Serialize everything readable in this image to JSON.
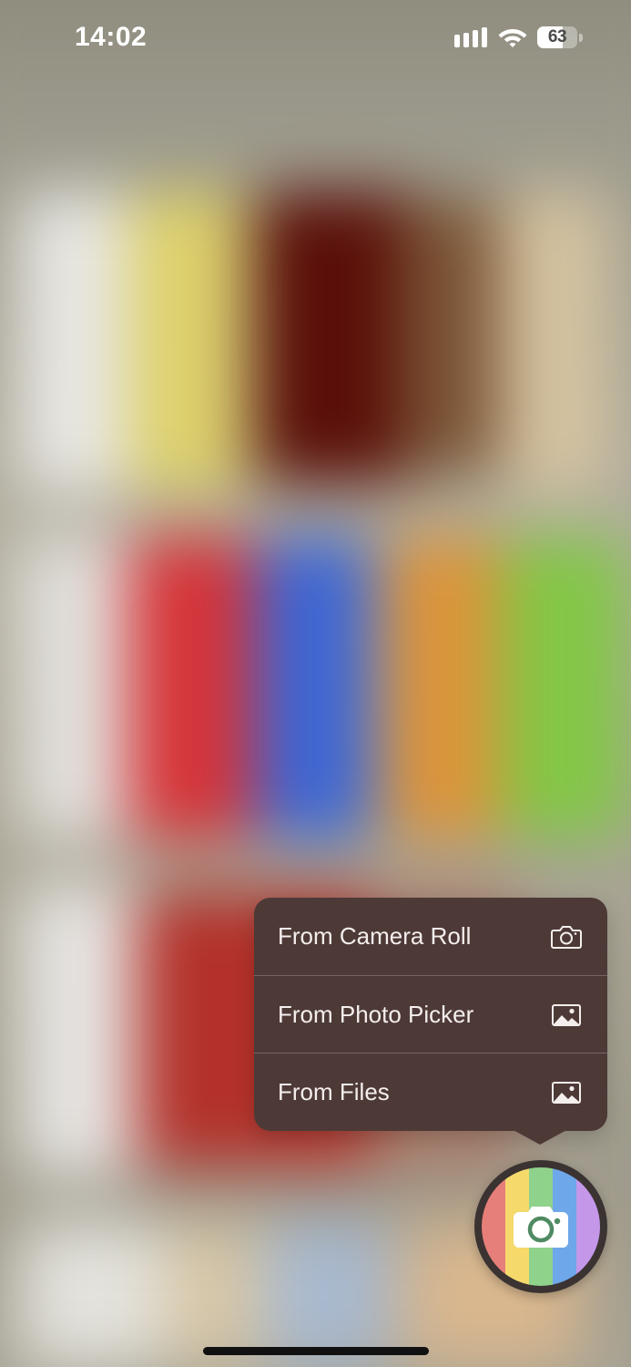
{
  "status_bar": {
    "time": "14:02",
    "battery_level": "63",
    "battery_fraction": 0.63
  },
  "menu": {
    "items": [
      {
        "label": "From Camera Roll",
        "icon": "camera-icon"
      },
      {
        "label": "From Photo Picker",
        "icon": "photo-icon"
      },
      {
        "label": "From Files",
        "icon": "photo-icon"
      }
    ]
  },
  "fab": {
    "icon": "camera-icon",
    "stripe_colors": [
      "#e67f79",
      "#f5d96b",
      "#8fd28b",
      "#6ea7ea",
      "#c497e9"
    ]
  },
  "colors": {
    "menu_background": "#4d3a37",
    "menu_text": "#f4eeec"
  }
}
